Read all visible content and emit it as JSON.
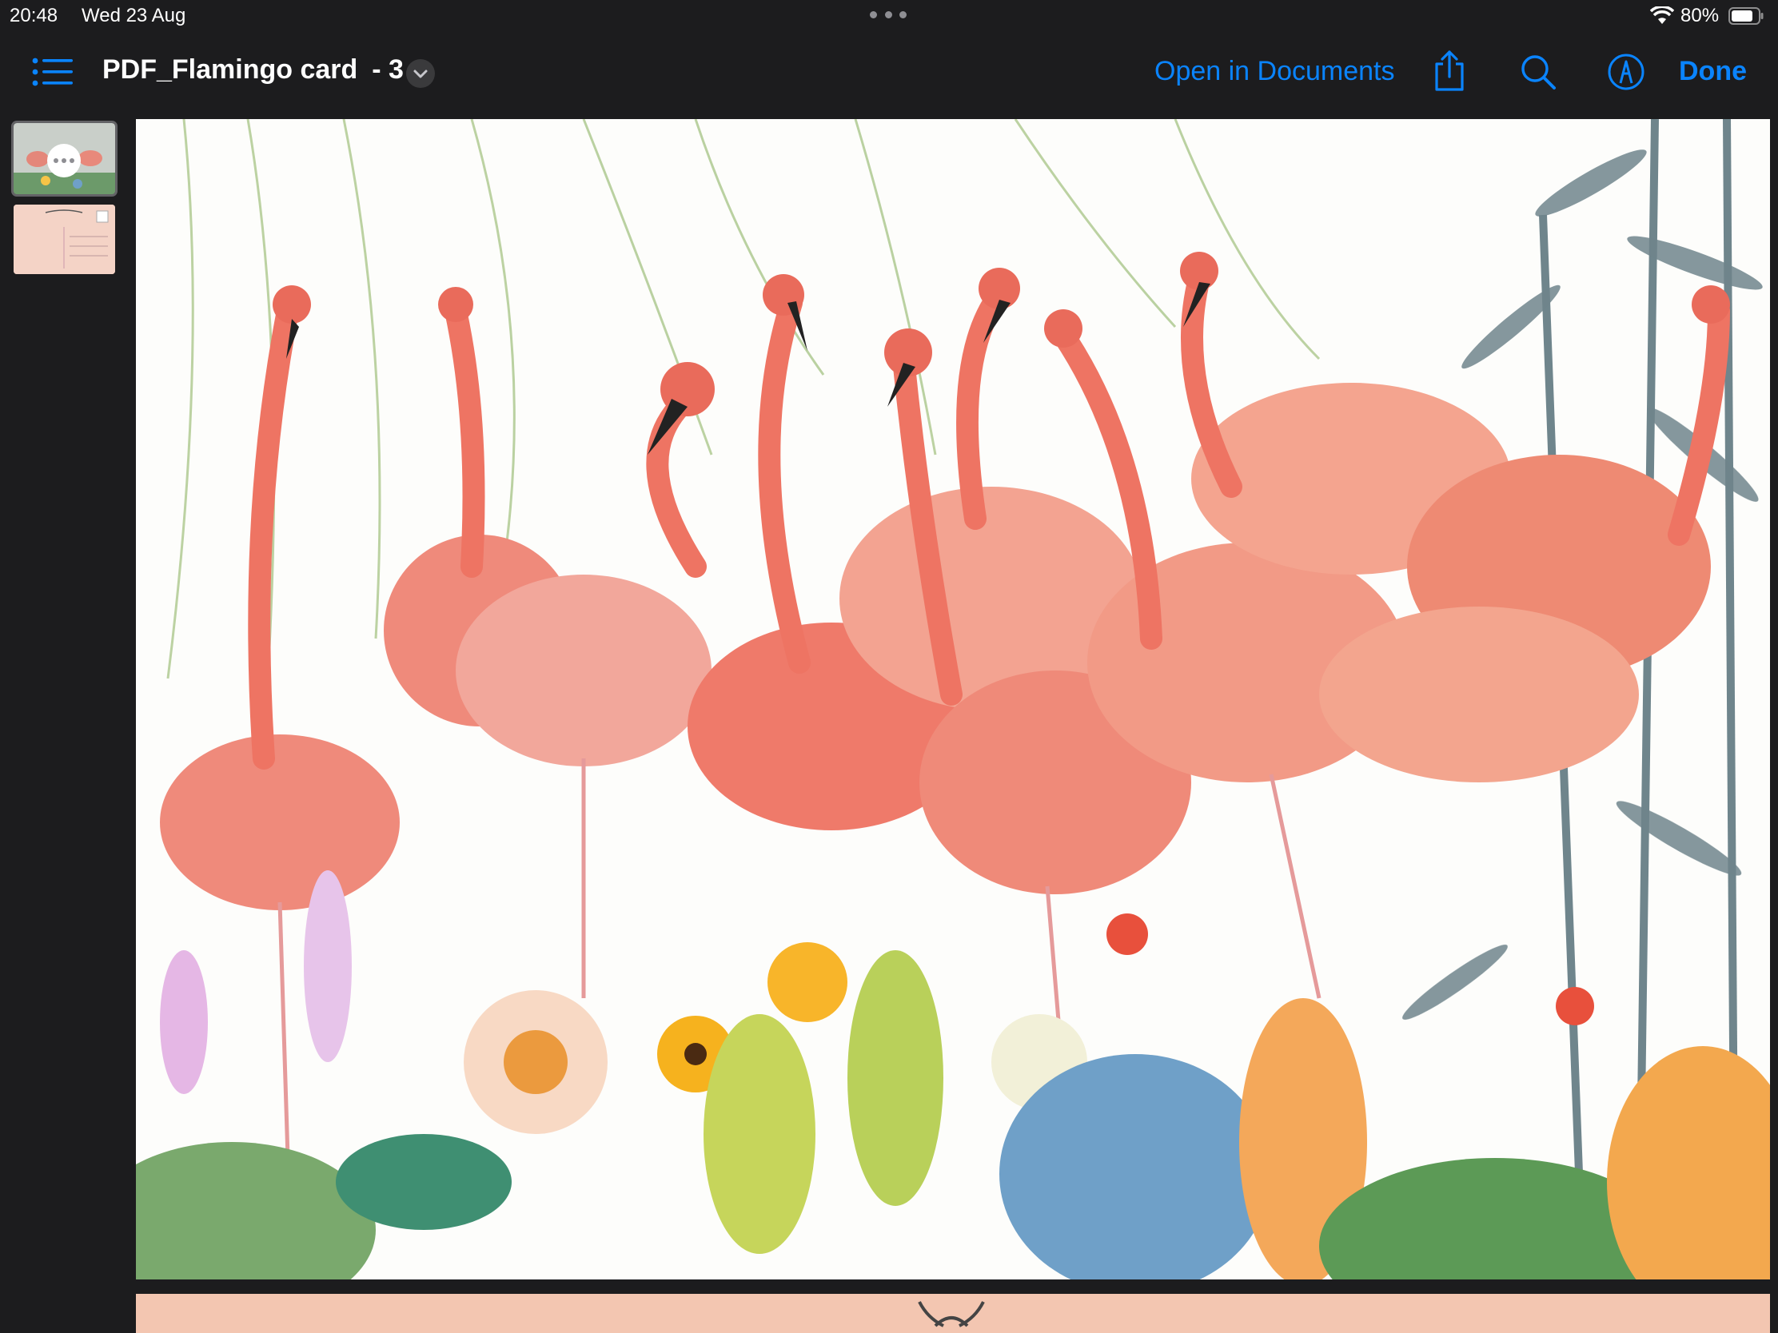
{
  "status_bar": {
    "time": "20:48",
    "date": "Wed 23 Aug",
    "battery_percent": "80%",
    "battery_level": 0.8
  },
  "nav": {
    "title": "PDF_Flamingo card",
    "page_suffix": "- 3",
    "open_in_documents": "Open in Documents",
    "done": "Done"
  },
  "icons": {
    "sidebar": "list-icon",
    "title_menu": "chevron-down-icon",
    "share": "share-icon",
    "search": "search-icon",
    "markup": "markup-pen-icon"
  },
  "sidebar": {
    "pages": [
      {
        "page": 1,
        "selected": true
      },
      {
        "page": 2,
        "selected": false
      }
    ]
  },
  "colors": {
    "accent": "#0a84ff",
    "background": "#1c1c1e",
    "flamingo": "#ef7a6a"
  }
}
